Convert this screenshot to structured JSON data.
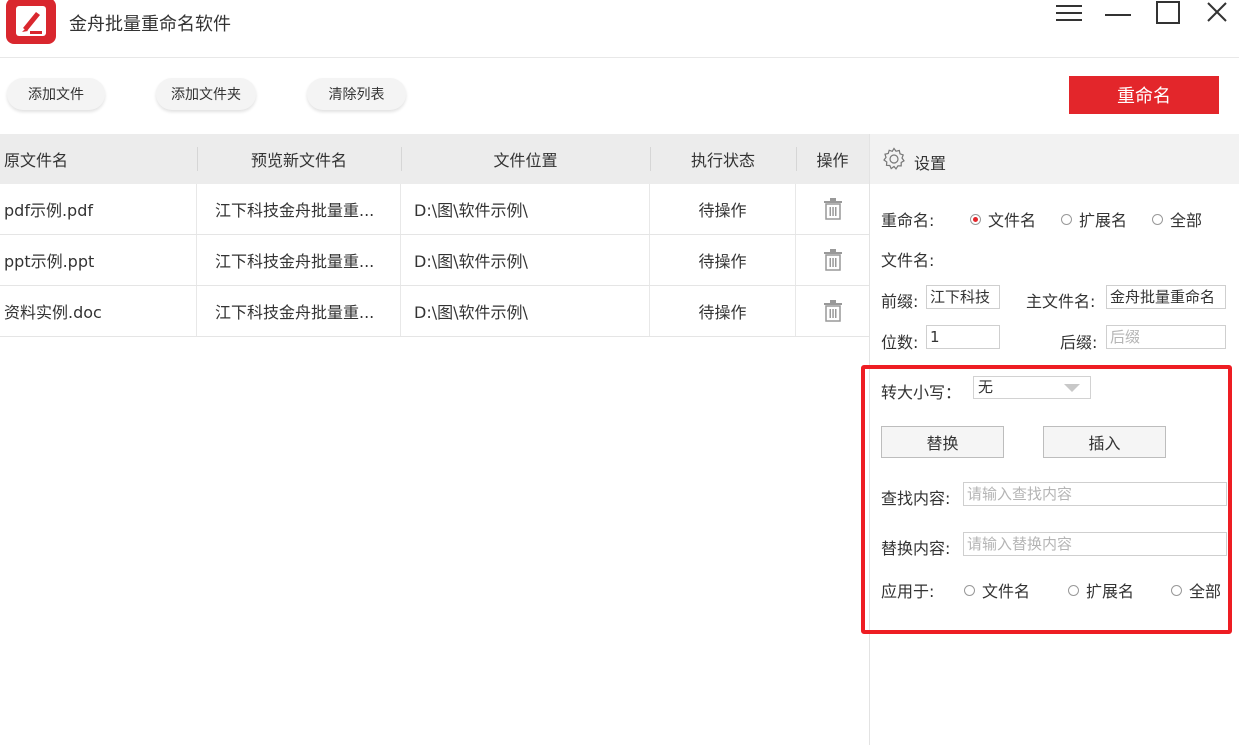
{
  "app": {
    "title": "金舟批量重命名软件",
    "icons": {
      "logo": "app-logo-icon",
      "menu": "menu-icon",
      "minimize": "minimize-icon",
      "maximize": "maximize-icon",
      "close": "close-icon"
    }
  },
  "toolbar": {
    "add_file": "添加文件",
    "add_folder": "添加文件夹",
    "clear_list": "清除列表",
    "rename": "重命名"
  },
  "table": {
    "columns": [
      "原文件名",
      "预览新文件名",
      "文件位置",
      "执行状态",
      "操作"
    ],
    "rows": [
      {
        "original": "pdf示例.pdf",
        "preview": "江下科技金舟批量重...",
        "location": "D:\\图\\软件示例\\",
        "status": "待操作",
        "action_icon": "trash-icon"
      },
      {
        "original": "ppt示例.ppt",
        "preview": "江下科技金舟批量重...",
        "location": "D:\\图\\软件示例\\",
        "status": "待操作",
        "action_icon": "trash-icon"
      },
      {
        "original": "资料实例.doc",
        "preview": "江下科技金舟批量重...",
        "location": "D:\\图\\软件示例\\",
        "status": "待操作",
        "action_icon": "trash-icon"
      }
    ]
  },
  "settings": {
    "title": "设置",
    "icon": "gear-icon",
    "rename_label": "重命名:",
    "rename_options": [
      "文件名",
      "扩展名",
      "全部"
    ],
    "rename_selected": "文件名",
    "filename_label": "文件名:",
    "prefix_label": "前缀:",
    "prefix_value": "江下科技",
    "main_name_label": "主文件名:",
    "main_name_value": "金舟批量重命名",
    "digits_label": "位数:",
    "digits_value": "1",
    "suffix_label": "后缀:",
    "suffix_placeholder": "后缀",
    "case_label": "转大小写：",
    "case_value": "无",
    "replace_button": "替换",
    "insert_button": "插入",
    "find_label": "查找内容:",
    "find_placeholder": "请输入查找内容",
    "replace_label": "替换内容:",
    "replace_placeholder": "请输入替换内容",
    "apply_label": "应用于:",
    "apply_options": [
      "文件名",
      "扩展名",
      "全部"
    ],
    "highlight_color": "#ee1d23"
  },
  "colors": {
    "accent": "#e3262b",
    "header_bg": "#ececec"
  }
}
